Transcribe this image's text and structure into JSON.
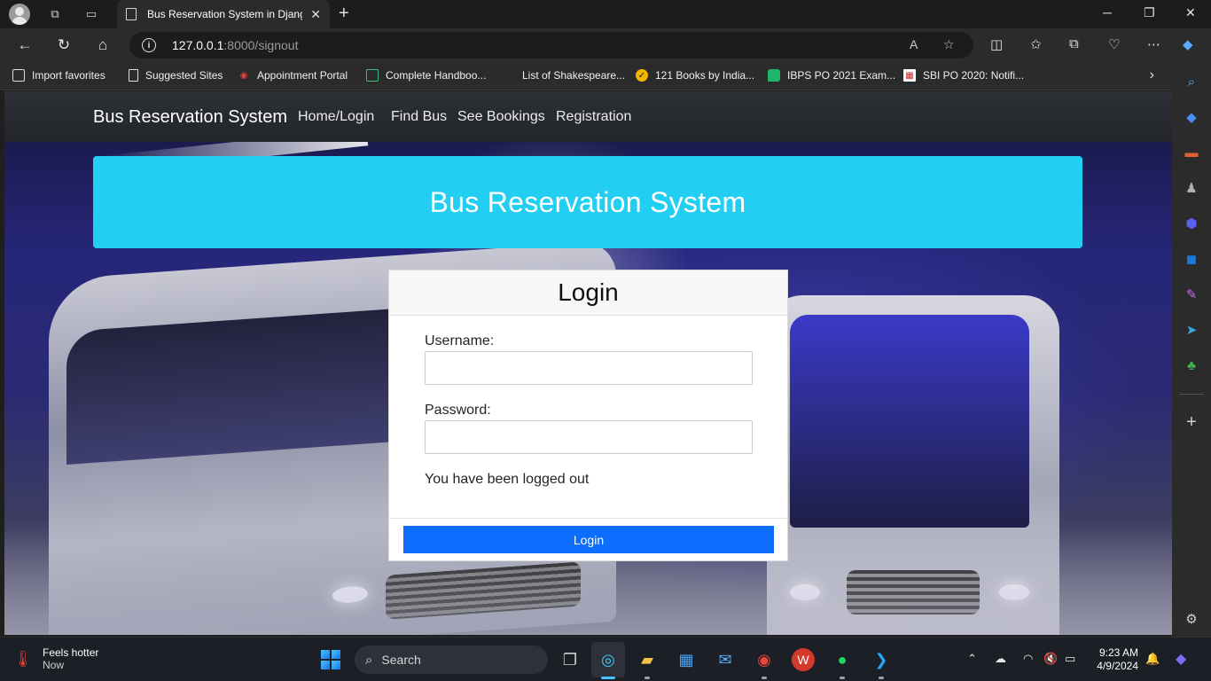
{
  "browser": {
    "tab_title": "Bus Reservation System in Django",
    "tab_close": "✕",
    "new_tab": "+",
    "url_host": "127.0.0.1",
    "url_rest": ":8000/signout",
    "favorites": [
      {
        "label": "Import favorites",
        "icon": "import-icon"
      },
      {
        "label": "Suggested Sites",
        "icon": "page-icon"
      },
      {
        "label": "Appointment Portal",
        "icon": "portal-icon"
      },
      {
        "label": "Complete Handboo...",
        "icon": "handbook-icon"
      },
      {
        "label": "List of Shakespeare...",
        "icon": "search-icon"
      },
      {
        "label": "121 Books by India...",
        "icon": "books-icon"
      },
      {
        "label": "IBPS PO 2021 Exam...",
        "icon": "ibps-icon"
      },
      {
        "label": "SBI PO 2020: Notifi...",
        "icon": "sbi-icon"
      }
    ]
  },
  "site": {
    "brand": "Bus Reservation System",
    "nav": [
      "Home/Login",
      "Find Bus",
      "See Bookings",
      "Registration"
    ],
    "hero_title": "Bus Reservation System"
  },
  "login": {
    "title": "Login",
    "username_label": "Username:",
    "password_label": "Password:",
    "username_value": "",
    "password_value": "",
    "message": "You have been logged out",
    "button_label": "Login",
    "button_color": "#0d6efd",
    "hero_color": "#22cef2"
  },
  "taskbar": {
    "weather_title": "Feels hotter",
    "weather_sub": "Now",
    "search_label": "Search",
    "time": "9:23 AM",
    "date": "4/9/2024"
  }
}
